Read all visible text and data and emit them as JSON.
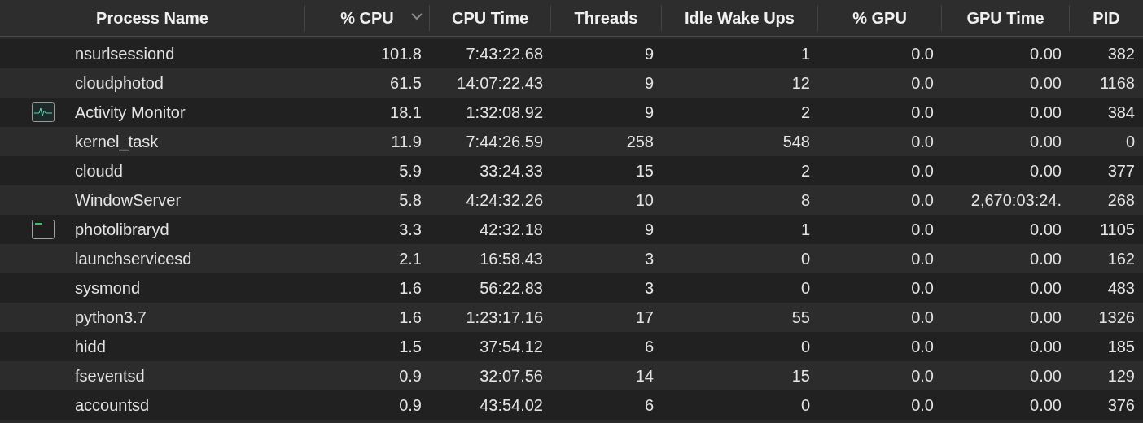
{
  "table": {
    "columns": [
      {
        "label": "Process Name",
        "sorted": false
      },
      {
        "label": "% CPU",
        "sorted": true
      },
      {
        "label": "CPU Time",
        "sorted": false
      },
      {
        "label": "Threads",
        "sorted": false
      },
      {
        "label": "Idle Wake Ups",
        "sorted": false
      },
      {
        "label": "% GPU",
        "sorted": false
      },
      {
        "label": "GPU Time",
        "sorted": false
      },
      {
        "label": "PID",
        "sorted": false
      }
    ],
    "rows": [
      {
        "kind": "plain",
        "cells": [
          "nsurlsessiond",
          "101.8",
          "7:43:22.68",
          "9",
          "1",
          "0.0",
          "0.00",
          "382"
        ]
      },
      {
        "kind": "plain",
        "cells": [
          "cloudphotod",
          "61.5",
          "14:07:22.43",
          "9",
          "12",
          "0.0",
          "0.00",
          "1168"
        ]
      },
      {
        "kind": "monitor",
        "cells": [
          "Activity Monitor",
          "18.1",
          "1:32:08.92",
          "9",
          "2",
          "0.0",
          "0.00",
          "384"
        ]
      },
      {
        "kind": "plain",
        "cells": [
          "kernel_task",
          "11.9",
          "7:44:26.59",
          "258",
          "548",
          "0.0",
          "0.00",
          "0"
        ]
      },
      {
        "kind": "plain",
        "cells": [
          "cloudd",
          "5.9",
          "33:24.33",
          "15",
          "2",
          "0.0",
          "0.00",
          "377"
        ]
      },
      {
        "kind": "plain",
        "cells": [
          "WindowServer",
          "5.8",
          "4:24:32.26",
          "10",
          "8",
          "0.0",
          "2,670:03:24.",
          "268"
        ]
      },
      {
        "kind": "console",
        "cells": [
          "photolibraryd",
          "3.3",
          "42:32.18",
          "9",
          "1",
          "0.0",
          "0.00",
          "1105"
        ]
      },
      {
        "kind": "plain",
        "cells": [
          "launchservicesd",
          "2.1",
          "16:58.43",
          "3",
          "0",
          "0.0",
          "0.00",
          "162"
        ]
      },
      {
        "kind": "plain",
        "cells": [
          "sysmond",
          "1.6",
          "56:22.83",
          "3",
          "0",
          "0.0",
          "0.00",
          "483"
        ]
      },
      {
        "kind": "plain",
        "cells": [
          "python3.7",
          "1.6",
          "1:23:17.16",
          "17",
          "55",
          "0.0",
          "0.00",
          "1326"
        ]
      },
      {
        "kind": "plain",
        "cells": [
          "hidd",
          "1.5",
          "37:54.12",
          "6",
          "0",
          "0.0",
          "0.00",
          "185"
        ]
      },
      {
        "kind": "plain",
        "cells": [
          "fseventsd",
          "0.9",
          "32:07.56",
          "14",
          "15",
          "0.0",
          "0.00",
          "129"
        ]
      },
      {
        "kind": "plain",
        "cells": [
          "accountsd",
          "0.9",
          "43:54.02",
          "6",
          "0",
          "0.0",
          "0.00",
          "376"
        ]
      }
    ]
  }
}
